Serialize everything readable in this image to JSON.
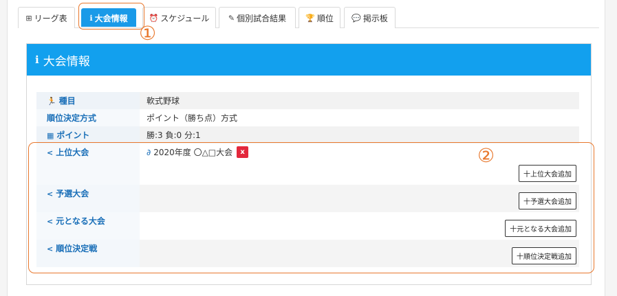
{
  "tabs": [
    {
      "label": "リーグ表",
      "icon": "grid-icon"
    },
    {
      "label": "大会情報",
      "icon": "info-icon"
    },
    {
      "label": "スケジュール",
      "icon": "clock-icon"
    },
    {
      "label": "個別試合結果",
      "icon": "pencil-icon"
    },
    {
      "label": "順位",
      "icon": "trophy-icon"
    },
    {
      "label": "掲示板",
      "icon": "comment-icon"
    }
  ],
  "annotations": {
    "one": "①",
    "two": "②"
  },
  "panel": {
    "title": "大会情報",
    "rows": [
      {
        "label": "種目",
        "value": "軟式野球",
        "icon": "runner-icon"
      },
      {
        "label": "順位決定方式",
        "value": "ポイント（勝ち点）方式"
      },
      {
        "label": "ポイント",
        "value": "勝:3 負:0 分:1",
        "icon": "calculator-icon"
      },
      {
        "label": "上位大会",
        "link": "2020年度 〇△□大会",
        "delete": "x",
        "button": "十上位大会追加",
        "icon": "share-icon"
      },
      {
        "label": "予選大会",
        "button": "十予選大会追加",
        "icon": "share-icon"
      },
      {
        "label": "元となる大会",
        "button": "十元となる大会追加",
        "icon": "share-icon"
      },
      {
        "label": "順位決定戦",
        "button": "十順位決定戦追加",
        "icon": "share-icon"
      }
    ]
  },
  "colors": {
    "accent": "#12a0ee",
    "annotation": "#e8772c",
    "danger": "#e3283c",
    "label": "#1a6fb8"
  }
}
